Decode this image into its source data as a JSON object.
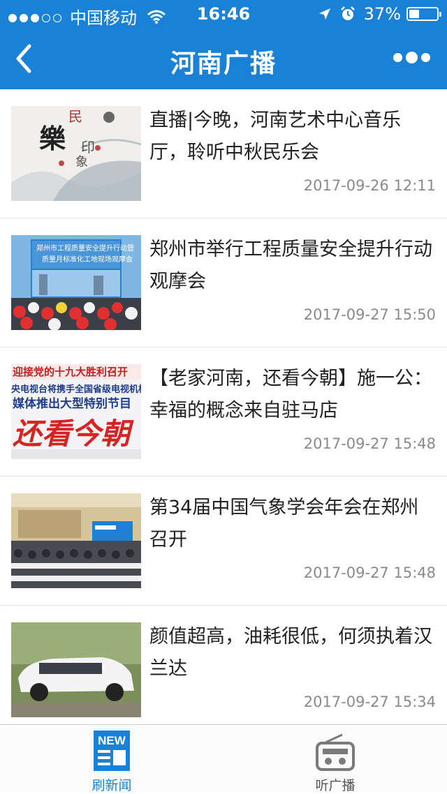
{
  "status_bar": {
    "carrier": "中国移动",
    "time": "16:46",
    "battery": "37%"
  },
  "nav": {
    "title": "河南广播",
    "back_icon": "chevron-left-icon",
    "more_icon": "more-dots-icon"
  },
  "news": [
    {
      "title": "直播|今晚，河南艺术中心音乐厅，聆听中秋民乐会",
      "date": "2017-09-26 12:11"
    },
    {
      "title": "郑州市举行工程质量安全提升行动观摩会",
      "date": "2017-09-27 15:50"
    },
    {
      "title": "【老家河南，还看今朝】施一公：幸福的概念来自驻马店",
      "date": "2017-09-27 15:48"
    },
    {
      "title": "第34届中国气象学会年会在郑州召开",
      "date": "2017-09-27 15:48"
    },
    {
      "title": "颜值超高，油耗很低，何须执着汉兰达",
      "date": "2017-09-27 15:34"
    }
  ],
  "thumb_text": {
    "t1_a": "民",
    "t1_b": "樂",
    "t1_c": "印",
    "t1_d": "象",
    "t2_a": "郑州市工程质量安全提升行动暨",
    "t2_b": "质量月标准化工地现场观摩会",
    "t3_a": "迎接党的十九大胜利召开",
    "t3_b": "央电视台将携手全国省级电视机构",
    "t3_c": "媒体推出大型特别节目",
    "t3_d": "还看今朝"
  },
  "tabbar": {
    "tabs": [
      {
        "label": "刷新闻",
        "icon": "news-icon",
        "icon_text": "NEW",
        "active": true
      },
      {
        "label": "听广播",
        "icon": "radio-icon",
        "active": false
      }
    ]
  },
  "colors": {
    "brand": "#1a82d6",
    "date": "#8a8a8a"
  }
}
